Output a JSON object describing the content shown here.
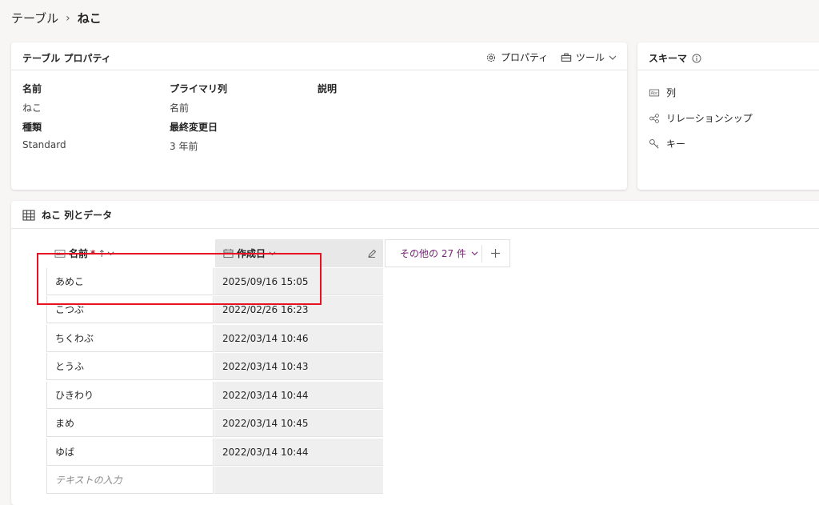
{
  "breadcrumb": {
    "parent": "テーブル",
    "separator": "›",
    "current": "ねこ"
  },
  "properties_card": {
    "title": "テーブル プロパティ",
    "properties_button": "プロパティ",
    "tools_button": "ツール",
    "fields": {
      "name_label": "名前",
      "name_value": "ねこ",
      "primary_label": "プライマリ列",
      "primary_value": "名前",
      "description_label": "説明",
      "type_label": "種類",
      "type_value": "Standard",
      "modified_label": "最終変更日",
      "modified_value": "3 年前"
    }
  },
  "schema_card": {
    "title": "スキーマ",
    "items": [
      "列",
      "リレーションシップ",
      "キー"
    ]
  },
  "data_card": {
    "title": "ねこ 列とデータ",
    "columns": {
      "name": "名前",
      "name_required": "*",
      "created": "作成日"
    },
    "more_columns": "その他の 27 件",
    "rows": [
      {
        "name": "あめこ",
        "created": "2025/09/16 15:05"
      },
      {
        "name": "こつぶ",
        "created": "2022/02/26 16:23"
      },
      {
        "name": "ちくわぶ",
        "created": "2022/03/14 10:46"
      },
      {
        "name": "とうふ",
        "created": "2022/03/14 10:43"
      },
      {
        "name": "ひきわり",
        "created": "2022/03/14 10:44"
      },
      {
        "name": "まめ",
        "created": "2022/03/14 10:45"
      },
      {
        "name": "ゆば",
        "created": "2022/03/14 10:44"
      }
    ],
    "new_row_placeholder": "テキストの入力"
  },
  "colors": {
    "accent": "#742774",
    "highlight": "#e81123"
  }
}
